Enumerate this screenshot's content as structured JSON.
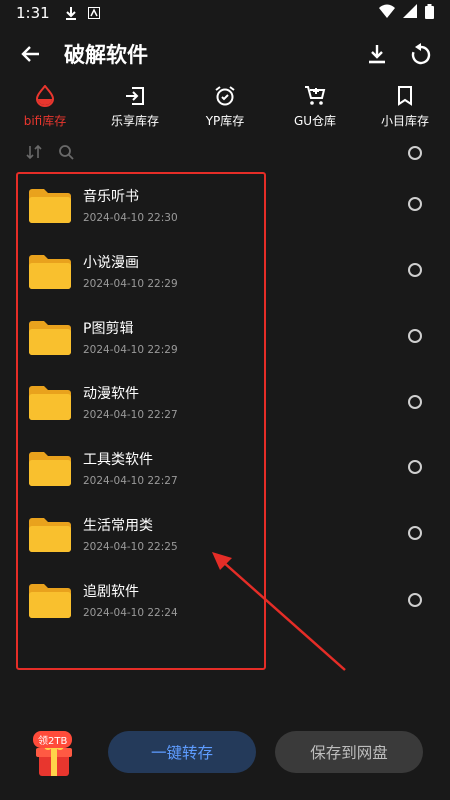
{
  "status_bar": {
    "time": "1:31"
  },
  "app_bar": {
    "title": "破解软件"
  },
  "tabs": [
    {
      "label": "bifi库存",
      "icon": "drop-icon",
      "active": true
    },
    {
      "label": "乐享库存",
      "icon": "login-icon",
      "active": false
    },
    {
      "label": "YP库存",
      "icon": "alarm-icon",
      "active": false
    },
    {
      "label": "GU仓库",
      "icon": "cart-icon",
      "active": false
    },
    {
      "label": "小目库存",
      "icon": "bookmark-icon",
      "active": false
    }
  ],
  "folders": [
    {
      "name": "音乐听书",
      "date": "2024-04-10 22:30"
    },
    {
      "name": "小说漫画",
      "date": "2024-04-10 22:29"
    },
    {
      "name": "P图剪辑",
      "date": "2024-04-10 22:29"
    },
    {
      "name": "动漫软件",
      "date": "2024-04-10 22:27"
    },
    {
      "name": "工具类软件",
      "date": "2024-04-10 22:27"
    },
    {
      "name": "生活常用类",
      "date": "2024-04-10 22:25"
    },
    {
      "name": "追剧软件",
      "date": "2024-04-10 22:24"
    }
  ],
  "bottom_bar": {
    "gift_badge": "领2TB",
    "primary_button": "一键转存",
    "secondary_button": "保存到网盘"
  },
  "colors": {
    "accent_red": "#e8362e",
    "primary_button_text": "#5e9cff",
    "folder_yellow": "#f7b92b"
  }
}
